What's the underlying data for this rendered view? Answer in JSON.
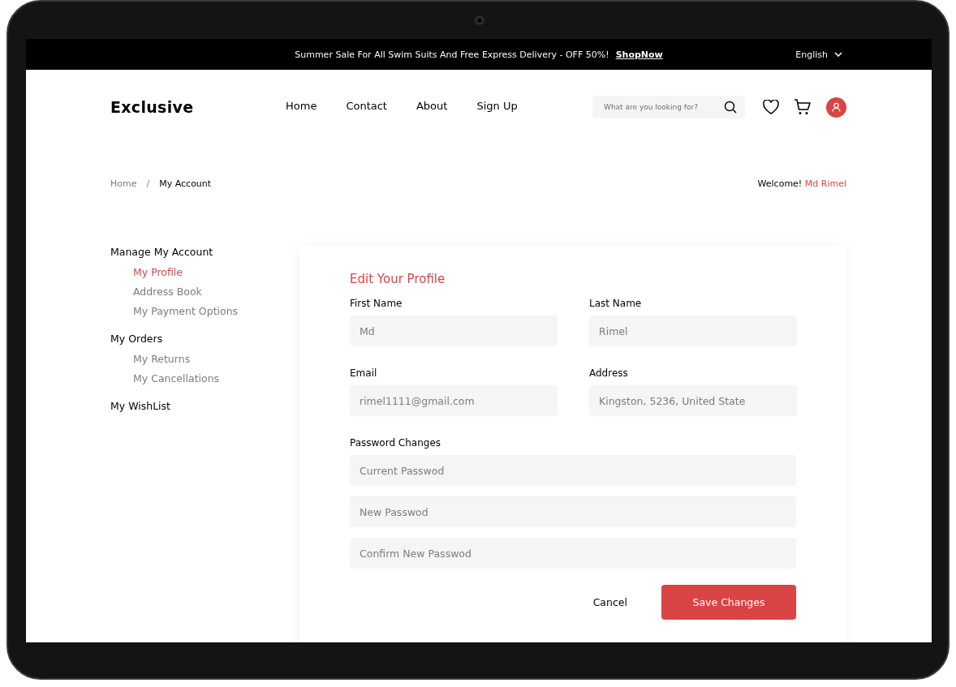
{
  "top_bar": {
    "announcement": "Summer Sale For All Swim Suits And Free Express Delivery - OFF 50%!",
    "link": "ShopNow",
    "language": "English"
  },
  "header": {
    "logo": "Exclusive",
    "nav": [
      {
        "label": "Home",
        "selected": false
      },
      {
        "label": "Contact",
        "selected": false
      },
      {
        "label": "About",
        "selected": false
      },
      {
        "label": "Sign Up",
        "selected": false
      }
    ],
    "search": {
      "placeholder": "What are you looking for?"
    }
  },
  "breadcrumb": {
    "items": [
      "Home",
      "My Account"
    ],
    "separator": "/"
  },
  "welcome": {
    "text": "Welcome!",
    "name": "Md Rimel"
  },
  "sidebar": [
    {
      "label": "Manage My Account",
      "children": [
        {
          "label": "My Profile",
          "selected": true
        },
        {
          "label": "Address Book",
          "selected": false
        },
        {
          "label": "My Payment Options",
          "selected": false
        }
      ]
    },
    {
      "label": "My Orders",
      "children": [
        {
          "label": "My Returns",
          "selected": false
        },
        {
          "label": "My Cancellations",
          "selected": false
        }
      ]
    },
    {
      "label": "My WishList"
    }
  ],
  "form": {
    "title": "Edit Your Profile",
    "fields": [
      {
        "label": "First Name",
        "value": "Md"
      },
      {
        "label": "Last Name",
        "value": "Rimel"
      },
      {
        "label": "Email",
        "value": "rimel1111@gmail.com"
      },
      {
        "label": "Address",
        "value": "Kingston, 5236, United State"
      }
    ],
    "password_label": "Password Changes",
    "password_fields": [
      {
        "placeholder": "Current Passwod"
      },
      {
        "placeholder": "New Passwod"
      },
      {
        "placeholder": "Confirm New Passwod"
      }
    ],
    "buttons": [
      {
        "kind": "text",
        "label": "Cancel"
      },
      {
        "kind": "primary",
        "label": "Save Changes"
      }
    ]
  }
}
